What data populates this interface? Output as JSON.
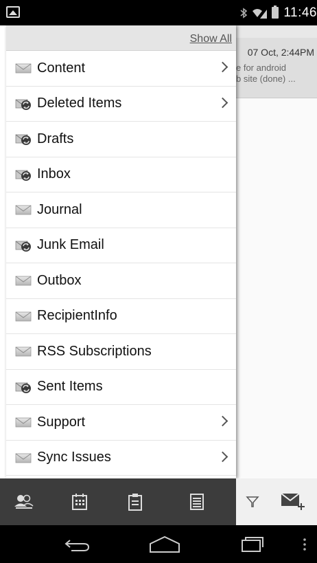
{
  "status_bar": {
    "time": "11:46",
    "icons": [
      "image-icon",
      "bluetooth-icon",
      "wifi-icon",
      "battery-icon"
    ]
  },
  "drawer": {
    "show_all_label": "Show All",
    "folders": [
      {
        "label": "Content",
        "icon": "mail-icon",
        "has_children": true
      },
      {
        "label": "Deleted Items",
        "icon": "sync-mail-icon",
        "has_children": true
      },
      {
        "label": "Drafts",
        "icon": "sync-mail-icon",
        "has_children": false
      },
      {
        "label": "Inbox",
        "icon": "sync-mail-icon",
        "has_children": false
      },
      {
        "label": "Journal",
        "icon": "mail-icon",
        "has_children": false
      },
      {
        "label": "Junk Email",
        "icon": "sync-mail-icon",
        "has_children": false
      },
      {
        "label": "Outbox",
        "icon": "mail-icon",
        "has_children": false
      },
      {
        "label": "RecipientInfo",
        "icon": "mail-icon",
        "has_children": false
      },
      {
        "label": "RSS Subscriptions",
        "icon": "mail-icon",
        "has_children": false
      },
      {
        "label": "Sent Items",
        "icon": "sync-mail-icon",
        "has_children": false
      },
      {
        "label": "Support",
        "icon": "mail-icon",
        "has_children": true
      },
      {
        "label": "Sync Issues",
        "icon": "mail-icon",
        "has_children": true
      }
    ]
  },
  "background_message": {
    "time": "07 Oct, 2:44PM",
    "line1": "e for android",
    "line2": "b site (done) ..."
  },
  "toolbar": {
    "icons": [
      "contacts-icon",
      "calendar-icon",
      "clipboard-icon",
      "notes-icon",
      "filter-icon",
      "compose-mail-icon"
    ]
  },
  "nav_bar": {
    "icons": [
      "back-icon",
      "home-icon",
      "recents-icon",
      "overflow-icon"
    ]
  },
  "colors": {
    "drawer_bg": "#ffffff",
    "toolbar_bg": "#3c3c3c",
    "header_bar": "#e5e5e5",
    "status_bar": "#000000"
  }
}
